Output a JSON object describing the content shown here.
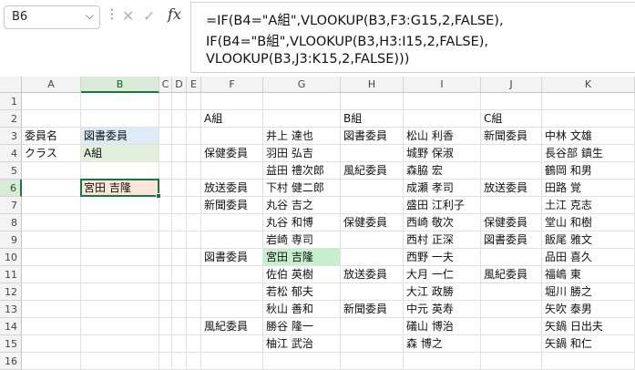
{
  "formula_bar": {
    "name_box": "B6",
    "cancel_icon": "✕",
    "enter_icon": "✓",
    "fx_label": "fx",
    "formula_lines": [
      "=IF(B4=\"A組\",VLOOKUP(B3,F3:G15,2,FALSE),",
      "IF(B4=\"B組\",VLOOKUP(B3,H3:I15,2,FALSE),",
      "VLOOKUP(B3,J3:K15,2,FALSE)))"
    ]
  },
  "columns": [
    "A",
    "B",
    "C",
    "D",
    "E",
    "F",
    "G",
    "H",
    "I",
    "J",
    "K"
  ],
  "rows": [
    "1",
    "2",
    "3",
    "4",
    "5",
    "6",
    "7",
    "8",
    "9",
    "10",
    "11",
    "12",
    "13",
    "14",
    "15",
    "16"
  ],
  "cells": {
    "A3": "委員名",
    "B3": "図書委員",
    "A4": "クラス",
    "B4": "A組",
    "B6": "宮田 吉隆",
    "F2": "A組",
    "H2": "B組",
    "J2": "C組",
    "G3": "井上 達也",
    "H3": "図書委員",
    "I3": "松山 利香",
    "J3": "新聞委員",
    "K3": "中林 文雄",
    "F4": "保健委員",
    "G4": "羽田 弘吉",
    "I4": "城野 保淑",
    "K4": "長谷部 鎮生",
    "G5": "益田 禮次郎",
    "H5": "風紀委員",
    "I5": "森脇 宏",
    "K5": "鶴岡 和男",
    "F6": "放送委員",
    "G6": "下村 健二郎",
    "I6": "成瀬 孝司",
    "J6": "放送委員",
    "K6": "田路 覚",
    "F7": "新聞委員",
    "G7": "丸谷 吉之",
    "I7": "盛田 江利子",
    "K7": "土江 克志",
    "G8": "丸谷 和博",
    "H8": "保健委員",
    "I8": "西崎 敬次",
    "J8": "保健委員",
    "K8": "堂山 和樹",
    "G9": "岩崎 専司",
    "I9": "西村 正深",
    "J9": "図書委員",
    "K9": "飯尾 雅文",
    "F10": "図書委員",
    "G10": "宮田 吉隆",
    "I10": "西野 一夫",
    "K10": "品田 喜久",
    "G11": "佐伯 英樹",
    "H11": "放送委員",
    "I11": "大月 一仁",
    "J11": "風紀委員",
    "K11": "福嶋 東",
    "G12": "若松 郁夫",
    "I12": "大江 政勝",
    "K12": "堀川 勝之",
    "G13": "秋山 善和",
    "H13": "新聞委員",
    "I13": "中元 英寿",
    "K13": "矢吹 泰男",
    "F14": "風紀委員",
    "G14": "勝谷 隆一",
    "I14": "礒山 博治",
    "K14": "矢鍋 日出夫",
    "G15": "柚江 武治",
    "I15": "森 博之",
    "K15": "矢鍋 和仁"
  },
  "colors": {
    "selection_green": "#107c41",
    "b3_fill": "#ddebf7",
    "b4_fill": "#e2efda",
    "b6_fill": "#fce4d6",
    "g10_fill": "#c6efce"
  }
}
